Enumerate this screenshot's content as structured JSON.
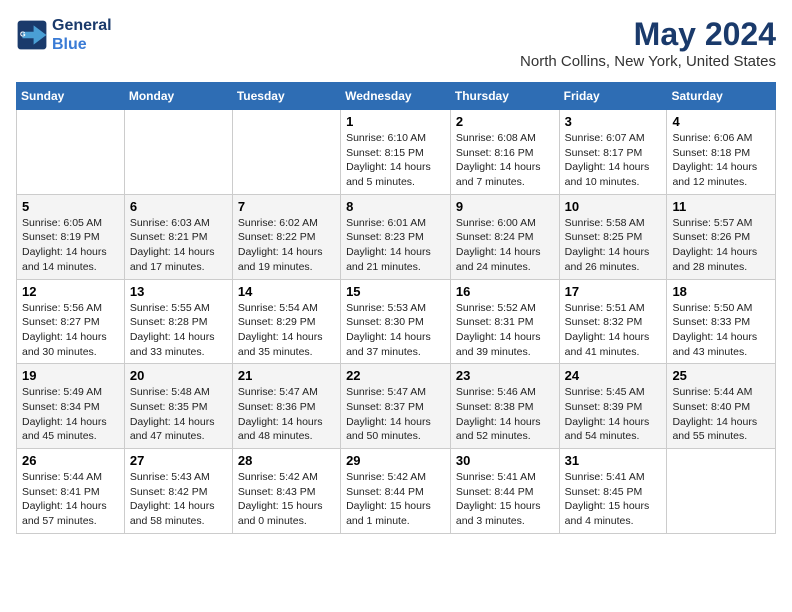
{
  "header": {
    "logo_line1": "General",
    "logo_line2": "Blue",
    "month": "May 2024",
    "location": "North Collins, New York, United States"
  },
  "days_of_week": [
    "Sunday",
    "Monday",
    "Tuesday",
    "Wednesday",
    "Thursday",
    "Friday",
    "Saturday"
  ],
  "weeks": [
    [
      {
        "day": "",
        "info": ""
      },
      {
        "day": "",
        "info": ""
      },
      {
        "day": "",
        "info": ""
      },
      {
        "day": "1",
        "info": "Sunrise: 6:10 AM\nSunset: 8:15 PM\nDaylight: 14 hours\nand 5 minutes."
      },
      {
        "day": "2",
        "info": "Sunrise: 6:08 AM\nSunset: 8:16 PM\nDaylight: 14 hours\nand 7 minutes."
      },
      {
        "day": "3",
        "info": "Sunrise: 6:07 AM\nSunset: 8:17 PM\nDaylight: 14 hours\nand 10 minutes."
      },
      {
        "day": "4",
        "info": "Sunrise: 6:06 AM\nSunset: 8:18 PM\nDaylight: 14 hours\nand 12 minutes."
      }
    ],
    [
      {
        "day": "5",
        "info": "Sunrise: 6:05 AM\nSunset: 8:19 PM\nDaylight: 14 hours\nand 14 minutes."
      },
      {
        "day": "6",
        "info": "Sunrise: 6:03 AM\nSunset: 8:21 PM\nDaylight: 14 hours\nand 17 minutes."
      },
      {
        "day": "7",
        "info": "Sunrise: 6:02 AM\nSunset: 8:22 PM\nDaylight: 14 hours\nand 19 minutes."
      },
      {
        "day": "8",
        "info": "Sunrise: 6:01 AM\nSunset: 8:23 PM\nDaylight: 14 hours\nand 21 minutes."
      },
      {
        "day": "9",
        "info": "Sunrise: 6:00 AM\nSunset: 8:24 PM\nDaylight: 14 hours\nand 24 minutes."
      },
      {
        "day": "10",
        "info": "Sunrise: 5:58 AM\nSunset: 8:25 PM\nDaylight: 14 hours\nand 26 minutes."
      },
      {
        "day": "11",
        "info": "Sunrise: 5:57 AM\nSunset: 8:26 PM\nDaylight: 14 hours\nand 28 minutes."
      }
    ],
    [
      {
        "day": "12",
        "info": "Sunrise: 5:56 AM\nSunset: 8:27 PM\nDaylight: 14 hours\nand 30 minutes."
      },
      {
        "day": "13",
        "info": "Sunrise: 5:55 AM\nSunset: 8:28 PM\nDaylight: 14 hours\nand 33 minutes."
      },
      {
        "day": "14",
        "info": "Sunrise: 5:54 AM\nSunset: 8:29 PM\nDaylight: 14 hours\nand 35 minutes."
      },
      {
        "day": "15",
        "info": "Sunrise: 5:53 AM\nSunset: 8:30 PM\nDaylight: 14 hours\nand 37 minutes."
      },
      {
        "day": "16",
        "info": "Sunrise: 5:52 AM\nSunset: 8:31 PM\nDaylight: 14 hours\nand 39 minutes."
      },
      {
        "day": "17",
        "info": "Sunrise: 5:51 AM\nSunset: 8:32 PM\nDaylight: 14 hours\nand 41 minutes."
      },
      {
        "day": "18",
        "info": "Sunrise: 5:50 AM\nSunset: 8:33 PM\nDaylight: 14 hours\nand 43 minutes."
      }
    ],
    [
      {
        "day": "19",
        "info": "Sunrise: 5:49 AM\nSunset: 8:34 PM\nDaylight: 14 hours\nand 45 minutes."
      },
      {
        "day": "20",
        "info": "Sunrise: 5:48 AM\nSunset: 8:35 PM\nDaylight: 14 hours\nand 47 minutes."
      },
      {
        "day": "21",
        "info": "Sunrise: 5:47 AM\nSunset: 8:36 PM\nDaylight: 14 hours\nand 48 minutes."
      },
      {
        "day": "22",
        "info": "Sunrise: 5:47 AM\nSunset: 8:37 PM\nDaylight: 14 hours\nand 50 minutes."
      },
      {
        "day": "23",
        "info": "Sunrise: 5:46 AM\nSunset: 8:38 PM\nDaylight: 14 hours\nand 52 minutes."
      },
      {
        "day": "24",
        "info": "Sunrise: 5:45 AM\nSunset: 8:39 PM\nDaylight: 14 hours\nand 54 minutes."
      },
      {
        "day": "25",
        "info": "Sunrise: 5:44 AM\nSunset: 8:40 PM\nDaylight: 14 hours\nand 55 minutes."
      }
    ],
    [
      {
        "day": "26",
        "info": "Sunrise: 5:44 AM\nSunset: 8:41 PM\nDaylight: 14 hours\nand 57 minutes."
      },
      {
        "day": "27",
        "info": "Sunrise: 5:43 AM\nSunset: 8:42 PM\nDaylight: 14 hours\nand 58 minutes."
      },
      {
        "day": "28",
        "info": "Sunrise: 5:42 AM\nSunset: 8:43 PM\nDaylight: 15 hours\nand 0 minutes."
      },
      {
        "day": "29",
        "info": "Sunrise: 5:42 AM\nSunset: 8:44 PM\nDaylight: 15 hours\nand 1 minute."
      },
      {
        "day": "30",
        "info": "Sunrise: 5:41 AM\nSunset: 8:44 PM\nDaylight: 15 hours\nand 3 minutes."
      },
      {
        "day": "31",
        "info": "Sunrise: 5:41 AM\nSunset: 8:45 PM\nDaylight: 15 hours\nand 4 minutes."
      },
      {
        "day": "",
        "info": ""
      }
    ]
  ]
}
